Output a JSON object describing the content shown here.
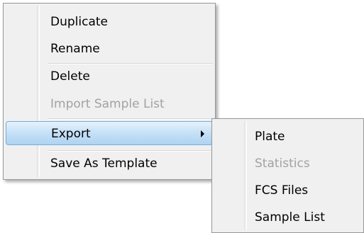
{
  "context_menu": {
    "items": [
      {
        "label": "Duplicate",
        "enabled": true
      },
      {
        "label": "Rename",
        "enabled": true
      },
      {
        "label": "Delete",
        "enabled": true
      },
      {
        "label": "Import Sample List",
        "enabled": false
      },
      {
        "label": "Export",
        "enabled": true,
        "highlighted": true,
        "has_submenu": true
      },
      {
        "label": "Save As Template",
        "enabled": true
      }
    ],
    "submenu_arrow_icon": "chevron-right-icon"
  },
  "export_submenu": {
    "items": [
      {
        "label": "Plate",
        "enabled": true
      },
      {
        "label": "Statistics",
        "enabled": false
      },
      {
        "label": "FCS Files",
        "enabled": true
      },
      {
        "label": "Sample List",
        "enabled": true
      }
    ]
  },
  "colors": {
    "menu_background": "#f0f0f0",
    "menu_border": "#979797",
    "highlight_top": "#e6f2fc",
    "highlight_bottom": "#aed3f1",
    "highlight_border": "#76acd9",
    "disabled_text": "#a2a2a2"
  }
}
